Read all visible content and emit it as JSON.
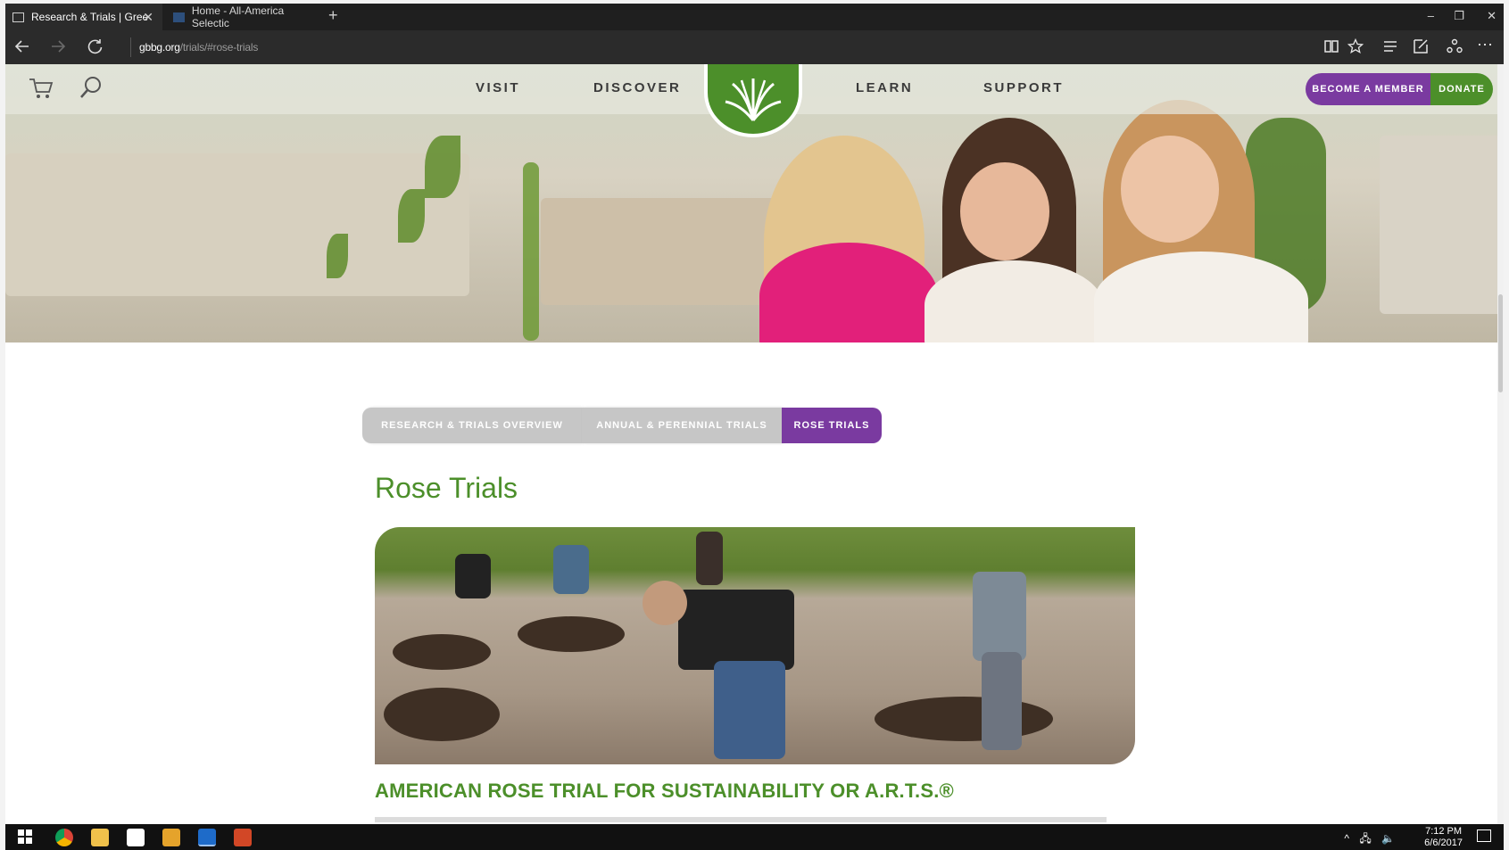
{
  "browser": {
    "tabs": [
      {
        "title": "Research & Trials | Gree",
        "close": "✕"
      },
      {
        "title": "Home - All-America Selectic"
      }
    ],
    "new_tab": "+",
    "window_controls": {
      "minimize": "–",
      "restore": "❐",
      "close": "✕"
    },
    "url_domain": "gbbg.org",
    "url_path": "/trials/#rose-trials",
    "more": "⋯"
  },
  "site": {
    "nav": {
      "visit": "VISIT",
      "discover": "DISCOVER",
      "learn": "LEARN",
      "support": "SUPPORT"
    },
    "become_member": "BECOME A MEMBER",
    "donate": "DONATE",
    "subtabs": {
      "overview": "RESEARCH & TRIALS OVERVIEW",
      "annual": "ANNUAL & PERENNIAL TRIALS",
      "rose": "ROSE TRIALS"
    },
    "page_title": "Rose Trials",
    "section_heading": "AMERICAN ROSE TRIAL FOR SUSTAINABILITY OR A.R.T.S.®"
  },
  "taskbar": {
    "time": "7:12 PM",
    "date": "6/6/2017",
    "tray": "^ 🖧 🔈"
  },
  "colors": {
    "brand_green": "#4c8f2a",
    "brand_purple": "#7a3aa0"
  }
}
